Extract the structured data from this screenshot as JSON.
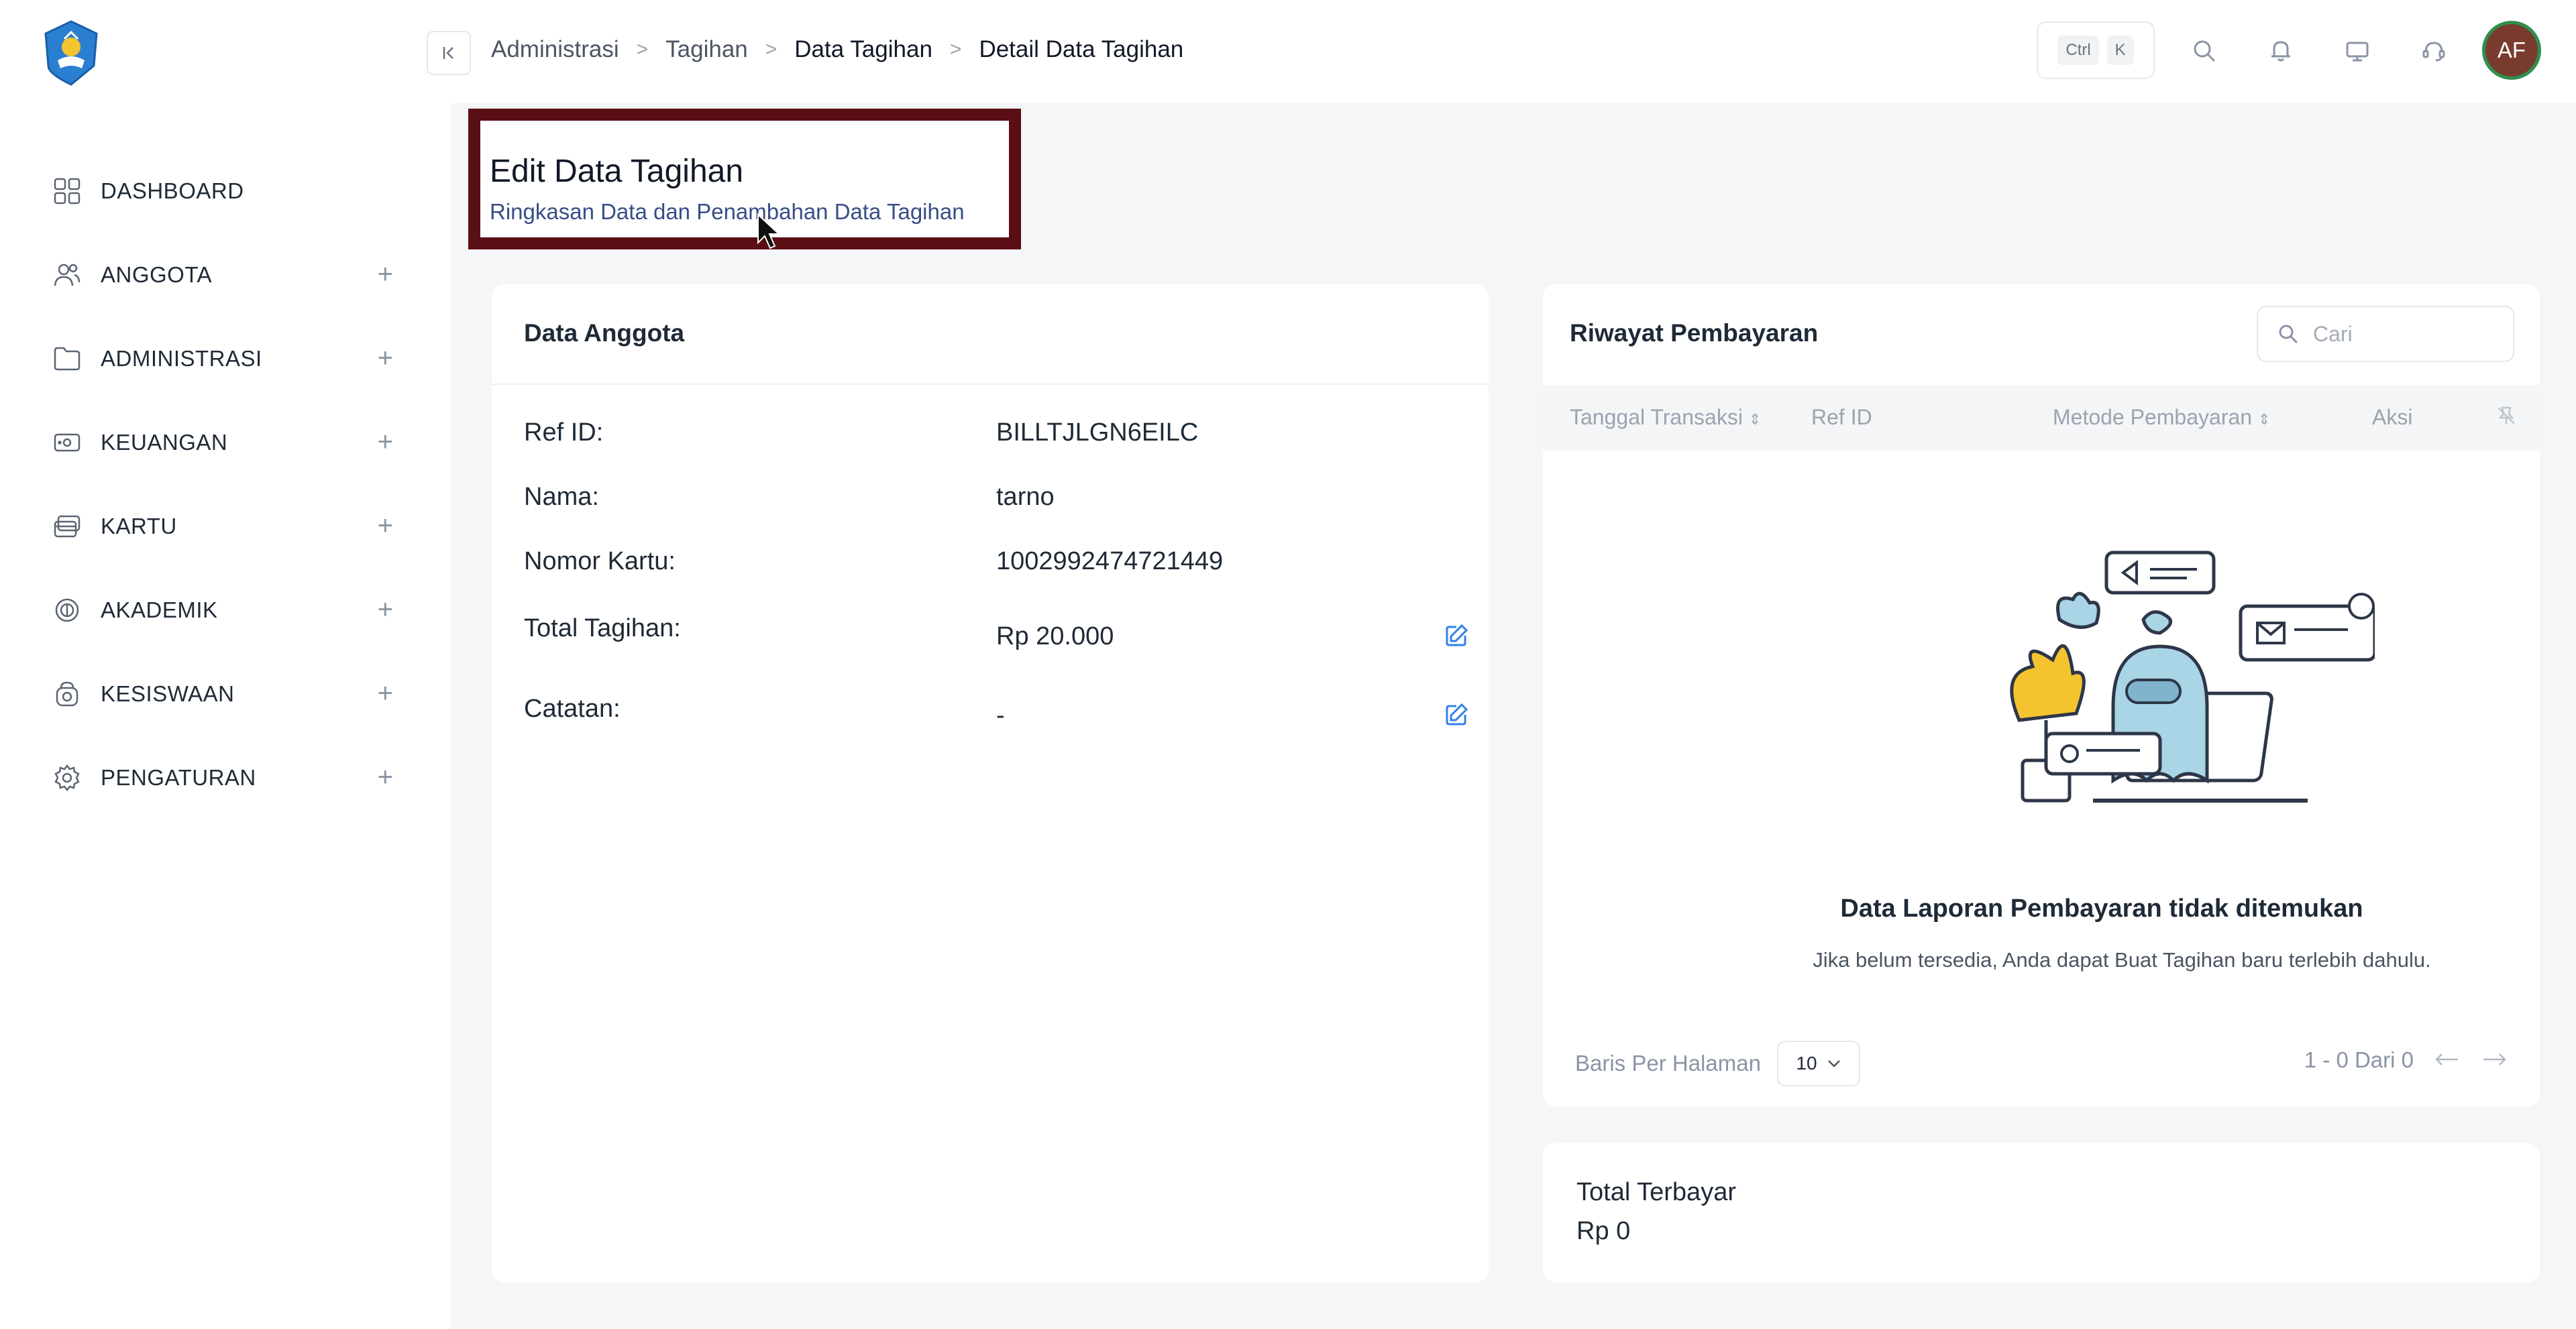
{
  "sidebar": {
    "logo_alt": "Tut Wuri Handayani",
    "items": [
      {
        "label": "DASHBOARD",
        "icon": "grid-icon",
        "expandable": false
      },
      {
        "label": "ANGGOTA",
        "icon": "users-icon",
        "expandable": true
      },
      {
        "label": "ADMINISTRASI",
        "icon": "folder-icon",
        "expandable": true
      },
      {
        "label": "KEUANGAN",
        "icon": "cash-icon",
        "expandable": true
      },
      {
        "label": "KARTU",
        "icon": "card-icon",
        "expandable": true
      },
      {
        "label": "AKADEMIK",
        "icon": "academic-icon",
        "expandable": true
      },
      {
        "label": "KESISWAAN",
        "icon": "student-icon",
        "expandable": true
      },
      {
        "label": "PENGATURAN",
        "icon": "settings-icon",
        "expandable": true
      }
    ],
    "expand_symbol": "+"
  },
  "breadcrumb": {
    "items": [
      "Administrasi",
      "Tagihan",
      "Data Tagihan",
      "Detail Data Tagihan"
    ],
    "separator": ">"
  },
  "topbar": {
    "shortcut_keys": [
      "Ctrl",
      "K"
    ],
    "avatar_initials": "AF"
  },
  "page": {
    "title": "Edit Data Tagihan",
    "subtitle": "Ringkasan Data dan Penambahan Data Tagihan"
  },
  "member_card": {
    "title": "Data Anggota",
    "fields": [
      {
        "label": "Ref ID:",
        "value": "BILLTJLGN6EILC"
      },
      {
        "label": "Nama:",
        "value": "tarno"
      },
      {
        "label": "Nomor Kartu:",
        "value": "1002992474721449"
      },
      {
        "label": "Total Tagihan:",
        "value": "Rp 20.000"
      },
      {
        "label": "Catatan:",
        "value": "-"
      }
    ]
  },
  "payment_history": {
    "title": "Riwayat Pembayaran",
    "search_placeholder": "Cari",
    "columns": [
      "Tanggal Transaksi",
      "Ref ID",
      "Metode Pembayaran",
      "Aksi"
    ],
    "empty_title": "Data Laporan Pembayaran tidak ditemukan",
    "empty_subtitle": "Jika belum tersedia, Anda dapat Buat Tagihan baru terlebih dahulu.",
    "rows_per_page_label": "Baris Per Halaman",
    "rows_per_page_value": "10",
    "pagination_text": "1 - 0 Dari 0"
  },
  "total_paid": {
    "label": "Total Terbayar",
    "value": "Rp 0"
  },
  "colors": {
    "highlight_border": "#5a0f14",
    "accent_blue": "#2f80ed",
    "avatar_bg": "#7a3b2f",
    "avatar_ring": "#2f8f4e"
  }
}
